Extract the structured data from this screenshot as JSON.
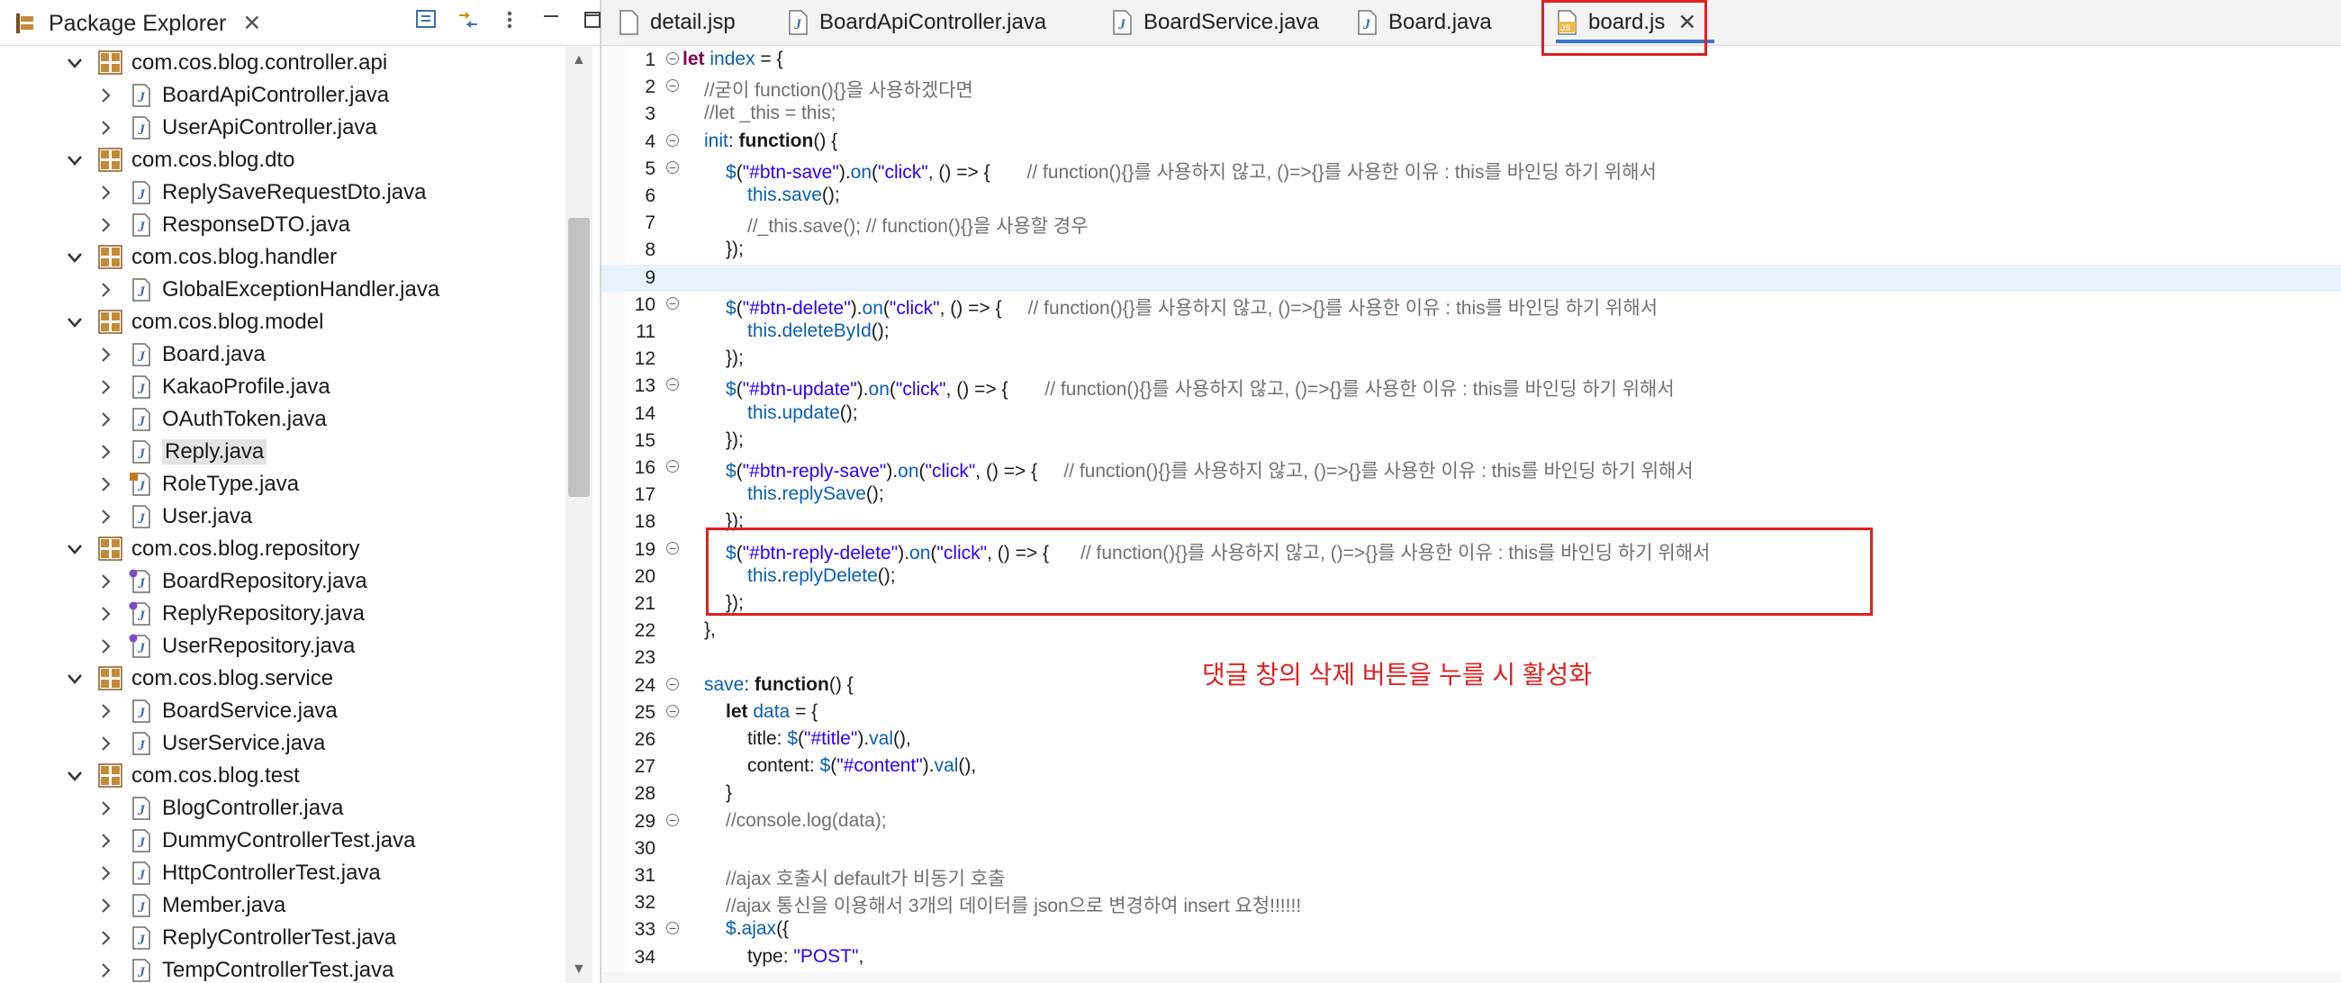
{
  "package_explorer": {
    "title": "Package Explorer",
    "close": "✕",
    "tree": [
      {
        "label": "com.cos.blog.controller.api",
        "kind": "package",
        "expanded": true
      },
      {
        "label": "BoardApiController.java",
        "kind": "java"
      },
      {
        "label": "UserApiController.java",
        "kind": "java"
      },
      {
        "label": "com.cos.blog.dto",
        "kind": "package",
        "expanded": true
      },
      {
        "label": "ReplySaveRequestDto.java",
        "kind": "java"
      },
      {
        "label": "ResponseDTO.java",
        "kind": "java"
      },
      {
        "label": "com.cos.blog.handler",
        "kind": "package",
        "expanded": true
      },
      {
        "label": "GlobalExceptionHandler.java",
        "kind": "java"
      },
      {
        "label": "com.cos.blog.model",
        "kind": "package",
        "expanded": true
      },
      {
        "label": "Board.java",
        "kind": "java"
      },
      {
        "label": "KakaoProfile.java",
        "kind": "java"
      },
      {
        "label": "OAuthToken.java",
        "kind": "java"
      },
      {
        "label": "Reply.java",
        "kind": "java",
        "selected": true
      },
      {
        "label": "RoleType.java",
        "kind": "enum"
      },
      {
        "label": "User.java",
        "kind": "java"
      },
      {
        "label": "com.cos.blog.repository",
        "kind": "package",
        "expanded": true
      },
      {
        "label": "BoardRepository.java",
        "kind": "interface"
      },
      {
        "label": "ReplyRepository.java",
        "kind": "interface"
      },
      {
        "label": "UserRepository.java",
        "kind": "interface"
      },
      {
        "label": "com.cos.blog.service",
        "kind": "package",
        "expanded": true
      },
      {
        "label": "BoardService.java",
        "kind": "java"
      },
      {
        "label": "UserService.java",
        "kind": "java"
      },
      {
        "label": "com.cos.blog.test",
        "kind": "package",
        "expanded": true
      },
      {
        "label": "BlogController.java",
        "kind": "java"
      },
      {
        "label": "DummyControllerTest.java",
        "kind": "java"
      },
      {
        "label": "HttpControllerTest.java",
        "kind": "java"
      },
      {
        "label": "Member.java",
        "kind": "java"
      },
      {
        "label": "ReplyControllerTest.java",
        "kind": "java"
      },
      {
        "label": "TempControllerTest.java",
        "kind": "java"
      }
    ]
  },
  "tabs": [
    {
      "label": "detail.jsp",
      "icon": "jsp-file-icon"
    },
    {
      "label": "BoardApiController.java",
      "icon": "java-file-icon"
    },
    {
      "label": "BoardService.java",
      "icon": "java-file-icon"
    },
    {
      "label": "Board.java",
      "icon": "java-file-icon"
    },
    {
      "label": "board.js",
      "icon": "js-file-icon",
      "active": true
    }
  ],
  "tab_close": "✕",
  "code_lines": [
    {
      "n": "1",
      "fold": true,
      "indent": 0,
      "tokens": [
        [
          "kw",
          "let"
        ],
        [
          "pl",
          " "
        ],
        [
          "prop",
          "index"
        ],
        [
          "pl",
          " = {"
        ]
      ]
    },
    {
      "n": "2",
      "fold": true,
      "indent": 1,
      "tokens": [
        [
          "cm",
          "//굳이 function(){}을 사용하겠다면"
        ]
      ]
    },
    {
      "n": "3",
      "indent": 1,
      "tokens": [
        [
          "cm",
          "//let _this = this;"
        ]
      ]
    },
    {
      "n": "4",
      "fold": true,
      "indent": 1,
      "tokens": [
        [
          "prop",
          "init"
        ],
        [
          "pl",
          ": "
        ],
        [
          "kwb",
          "function"
        ],
        [
          "pl",
          "() {"
        ]
      ]
    },
    {
      "n": "5",
      "fold": true,
      "indent": 2,
      "tokens": [
        [
          "fn",
          "$"
        ],
        [
          "pl",
          "("
        ],
        [
          "str",
          "\"#btn-save\""
        ],
        [
          "pl",
          ")."
        ],
        [
          "fn",
          "on"
        ],
        [
          "pl",
          "("
        ],
        [
          "str",
          "\"click\""
        ],
        [
          "pl",
          ", () => {       "
        ],
        [
          "cm",
          "// function(){}를 사용하지 않고, ()=>{}를 사용한 이유 : this를 바인딩 하기 위해서"
        ]
      ]
    },
    {
      "n": "6",
      "indent": 3,
      "tokens": [
        [
          "prop",
          "this"
        ],
        [
          "pl",
          "."
        ],
        [
          "fn",
          "save"
        ],
        [
          "pl",
          "();"
        ]
      ]
    },
    {
      "n": "7",
      "indent": 3,
      "tokens": [
        [
          "cm",
          "//_this.save(); // function(){}을 사용할 경우"
        ]
      ]
    },
    {
      "n": "8",
      "indent": 2,
      "tokens": [
        [
          "pl",
          "});"
        ]
      ]
    },
    {
      "n": "9",
      "indent": 0,
      "hl": true,
      "tokens": []
    },
    {
      "n": "10",
      "fold": true,
      "indent": 2,
      "tokens": [
        [
          "fn",
          "$"
        ],
        [
          "pl",
          "("
        ],
        [
          "str",
          "\"#btn-delete\""
        ],
        [
          "pl",
          ")."
        ],
        [
          "fn",
          "on"
        ],
        [
          "pl",
          "("
        ],
        [
          "str",
          "\"click\""
        ],
        [
          "pl",
          ", () => {     "
        ],
        [
          "cm",
          "// function(){}를 사용하지 않고, ()=>{}를 사용한 이유 : this를 바인딩 하기 위해서"
        ]
      ]
    },
    {
      "n": "11",
      "indent": 3,
      "tokens": [
        [
          "prop",
          "this"
        ],
        [
          "pl",
          "."
        ],
        [
          "fn",
          "deleteById"
        ],
        [
          "pl",
          "();"
        ]
      ]
    },
    {
      "n": "12",
      "indent": 2,
      "tokens": [
        [
          "pl",
          "});"
        ]
      ]
    },
    {
      "n": "13",
      "fold": true,
      "indent": 2,
      "tokens": [
        [
          "fn",
          "$"
        ],
        [
          "pl",
          "("
        ],
        [
          "str",
          "\"#btn-update\""
        ],
        [
          "pl",
          ")."
        ],
        [
          "fn",
          "on"
        ],
        [
          "pl",
          "("
        ],
        [
          "str",
          "\"click\""
        ],
        [
          "pl",
          ", () => {       "
        ],
        [
          "cm",
          "// function(){}를 사용하지 않고, ()=>{}를 사용한 이유 : this를 바인딩 하기 위해서"
        ]
      ]
    },
    {
      "n": "14",
      "indent": 3,
      "tokens": [
        [
          "prop",
          "this"
        ],
        [
          "pl",
          "."
        ],
        [
          "fn",
          "update"
        ],
        [
          "pl",
          "();"
        ]
      ]
    },
    {
      "n": "15",
      "indent": 2,
      "tokens": [
        [
          "pl",
          "});"
        ]
      ]
    },
    {
      "n": "16",
      "fold": true,
      "indent": 2,
      "tokens": [
        [
          "fn",
          "$"
        ],
        [
          "pl",
          "("
        ],
        [
          "str",
          "\"#btn-reply-save\""
        ],
        [
          "pl",
          ")."
        ],
        [
          "fn",
          "on"
        ],
        [
          "pl",
          "("
        ],
        [
          "str",
          "\"click\""
        ],
        [
          "pl",
          ", () => {     "
        ],
        [
          "cm",
          "// function(){}를 사용하지 않고, ()=>{}를 사용한 이유 : this를 바인딩 하기 위해서"
        ]
      ]
    },
    {
      "n": "17",
      "indent": 3,
      "tokens": [
        [
          "prop",
          "this"
        ],
        [
          "pl",
          "."
        ],
        [
          "fn",
          "replySave"
        ],
        [
          "pl",
          "();"
        ]
      ]
    },
    {
      "n": "18",
      "indent": 2,
      "tokens": [
        [
          "pl",
          "});"
        ]
      ]
    },
    {
      "n": "19",
      "fold": true,
      "indent": 2,
      "tokens": [
        [
          "fn",
          "$"
        ],
        [
          "pl",
          "("
        ],
        [
          "str",
          "\"#btn-reply-delete\""
        ],
        [
          "pl",
          ")."
        ],
        [
          "fn",
          "on"
        ],
        [
          "pl",
          "("
        ],
        [
          "str",
          "\"click\""
        ],
        [
          "pl",
          ", () => {      "
        ],
        [
          "cm",
          "// function(){}를 사용하지 않고, ()=>{}를 사용한 이유 : this를 바인딩 하기 위해서"
        ]
      ]
    },
    {
      "n": "20",
      "indent": 3,
      "tokens": [
        [
          "prop",
          "this"
        ],
        [
          "pl",
          "."
        ],
        [
          "fn",
          "replyDelete"
        ],
        [
          "pl",
          "();"
        ]
      ]
    },
    {
      "n": "21",
      "indent": 2,
      "tokens": [
        [
          "pl",
          "});"
        ]
      ]
    },
    {
      "n": "22",
      "indent": 1,
      "tokens": [
        [
          "pl",
          "},"
        ]
      ]
    },
    {
      "n": "23",
      "indent": 0,
      "tokens": []
    },
    {
      "n": "24",
      "fold": true,
      "indent": 1,
      "tokens": [
        [
          "prop",
          "save"
        ],
        [
          "pl",
          ": "
        ],
        [
          "kwb",
          "function"
        ],
        [
          "pl",
          "() {"
        ]
      ]
    },
    {
      "n": "25",
      "fold": true,
      "indent": 2,
      "tokens": [
        [
          "kwb",
          "let"
        ],
        [
          "pl",
          " "
        ],
        [
          "prop",
          "data"
        ],
        [
          "pl",
          " = {"
        ]
      ]
    },
    {
      "n": "26",
      "indent": 3,
      "tokens": [
        [
          "pl",
          "title: "
        ],
        [
          "fn",
          "$"
        ],
        [
          "pl",
          "("
        ],
        [
          "str",
          "\"#title\""
        ],
        [
          "pl",
          ")."
        ],
        [
          "fn",
          "val"
        ],
        [
          "pl",
          "(),"
        ]
      ]
    },
    {
      "n": "27",
      "indent": 3,
      "tokens": [
        [
          "pl",
          "content: "
        ],
        [
          "fn",
          "$"
        ],
        [
          "pl",
          "("
        ],
        [
          "str",
          "\"#content\""
        ],
        [
          "pl",
          ")."
        ],
        [
          "fn",
          "val"
        ],
        [
          "pl",
          "(),"
        ]
      ]
    },
    {
      "n": "28",
      "indent": 2,
      "tokens": [
        [
          "pl",
          "}"
        ]
      ]
    },
    {
      "n": "29",
      "fold": true,
      "indent": 2,
      "tokens": [
        [
          "cm",
          "//console.log(data);"
        ]
      ]
    },
    {
      "n": "30",
      "indent": 0,
      "tokens": []
    },
    {
      "n": "31",
      "indent": 2,
      "tokens": [
        [
          "cm",
          "//ajax 호출시 default가 비동기 호출"
        ]
      ]
    },
    {
      "n": "32",
      "indent": 2,
      "tokens": [
        [
          "cm",
          "//ajax 통신을 이용해서 3개의 데이터를 json으로 변경하여 insert 요청!!!!!!"
        ]
      ]
    },
    {
      "n": "33",
      "fold": true,
      "indent": 2,
      "tokens": [
        [
          "fn",
          "$"
        ],
        [
          "pl",
          "."
        ],
        [
          "fn",
          "ajax"
        ],
        [
          "pl",
          "({"
        ]
      ]
    },
    {
      "n": "34",
      "indent": 3,
      "tokens": [
        [
          "pl",
          "type: "
        ],
        [
          "str",
          "\"POST\""
        ],
        [
          "pl",
          ","
        ]
      ]
    }
  ],
  "annotation": "댓글 창의 삭제 버튼을 누를 시 활성화",
  "colors": {
    "highlight_box": "#e02020",
    "active_tab_underline": "#3a74d6"
  }
}
